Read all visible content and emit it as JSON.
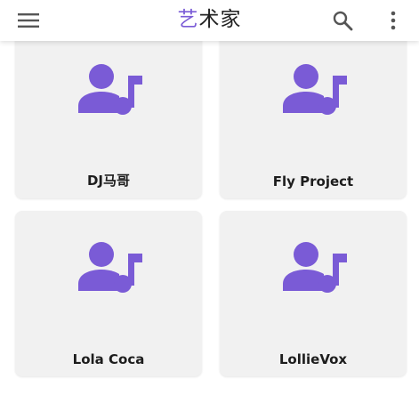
{
  "app_bar": {
    "title_accent": "艺",
    "title_rest": "术家"
  },
  "colors": {
    "accent": "#7A5BD6",
    "card_background": "#F1F1F1"
  },
  "icons": {
    "menu": "hamburger-menu-icon",
    "search": "search-icon",
    "more": "more-vert-icon",
    "artist": "artist-music-note-icon"
  },
  "artists": [
    {
      "name": "DJ马哥"
    },
    {
      "name": "Fly Project"
    },
    {
      "name": "Lola Coca"
    },
    {
      "name": "LollieVox"
    }
  ]
}
